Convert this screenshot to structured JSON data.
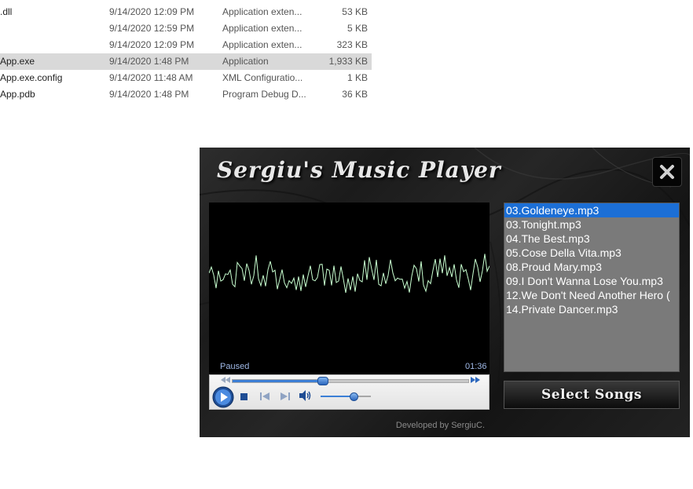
{
  "explorer": {
    "files": [
      {
        "name": ".dll",
        "date": "9/14/2020 12:09 PM",
        "type": "Application exten...",
        "size": "53 KB",
        "selected": false
      },
      {
        "name": "",
        "date": "9/14/2020 12:59 PM",
        "type": "Application exten...",
        "size": "5 KB",
        "selected": false
      },
      {
        "name": "",
        "date": "9/14/2020 12:09 PM",
        "type": "Application exten...",
        "size": "323 KB",
        "selected": false
      },
      {
        "name": "App.exe",
        "date": "9/14/2020 1:48 PM",
        "type": "Application",
        "size": "1,933 KB",
        "selected": true
      },
      {
        "name": "App.exe.config",
        "date": "9/14/2020 11:48 AM",
        "type": "XML Configuratio...",
        "size": "1 KB",
        "selected": false
      },
      {
        "name": "App.pdb",
        "date": "9/14/2020 1:48 PM",
        "type": "Program Debug D...",
        "size": "36 KB",
        "selected": false
      }
    ]
  },
  "player": {
    "title": "Sergiu's Music Player",
    "close_icon": "close-icon",
    "status": "Paused",
    "time": "01:36",
    "seek_progress": 0.38,
    "volume_level": 0.65,
    "playlist": [
      {
        "label": "03.Goldeneye.mp3",
        "active": true
      },
      {
        "label": "03.Tonight.mp3",
        "active": false
      },
      {
        "label": "04.The Best.mp3",
        "active": false
      },
      {
        "label": "05.Cose Della Vita.mp3",
        "active": false
      },
      {
        "label": "08.Proud Mary.mp3",
        "active": false
      },
      {
        "label": "09.I Don't Wanna Lose You.mp3",
        "active": false
      },
      {
        "label": "12.We Don't Need Another Hero (",
        "active": false
      },
      {
        "label": "14.Private Dancer.mp3",
        "active": false
      }
    ],
    "select_songs_label": "Select Songs",
    "developer_text": "Developed by SergiuC.",
    "colors": {
      "accent": "#1c6fd6",
      "waveform": "#c8ffd0",
      "playlist_bg": "#7a7a7a"
    }
  }
}
